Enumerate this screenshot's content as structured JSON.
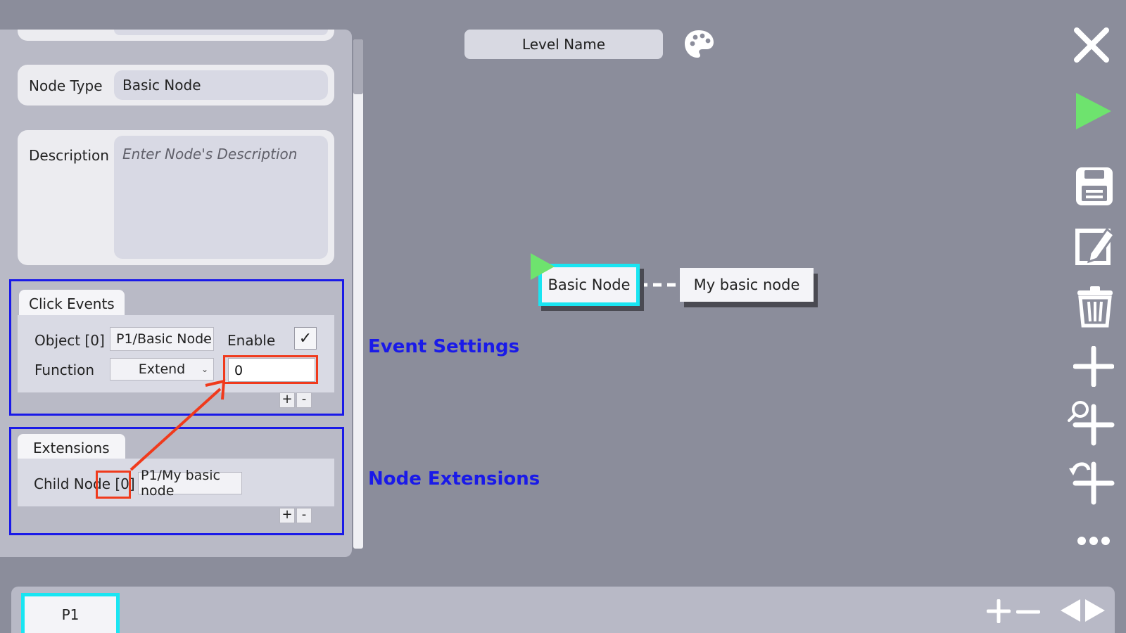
{
  "header": {
    "level_name": "Level Name"
  },
  "inspector": {
    "node_type_label": "Node Type",
    "node_type_value": "Basic Node",
    "description_label": "Description",
    "description_placeholder": "Enter Node's Description",
    "click_events": {
      "tab_label": "Click Events",
      "object_label": "Object [0]",
      "object_value": "P1/Basic Node",
      "enable_label": "Enable",
      "enable_checked": true,
      "function_label": "Function",
      "function_value": "Extend",
      "argument_value": "0",
      "add_label": "+",
      "remove_label": "-"
    },
    "extensions": {
      "tab_label": "Extensions",
      "child_node_label": "Child Node [0]",
      "child_node_value": "P1/My basic node",
      "add_label": "+",
      "remove_label": "-"
    }
  },
  "annotations": {
    "event_settings": "Event Settings",
    "node_extensions": "Node Extensions",
    "highlight_color": "#f03a1c",
    "section_color": "#1a1ae8"
  },
  "graph": {
    "nodes": [
      {
        "label": "Basic Node",
        "selected": true,
        "start": true
      },
      {
        "label": "My basic node",
        "selected": false,
        "start": false
      }
    ],
    "selection_color": "#19e5f2",
    "start_color": "#6ee36e"
  },
  "toolbar": {
    "icons": [
      "close-icon",
      "play-icon",
      "save-icon",
      "edit-icon",
      "trash-icon",
      "add-icon",
      "zoom-add-icon",
      "undo-add-icon",
      "more-icon"
    ],
    "play_color": "#6ee36e"
  },
  "pages": {
    "tabs": [
      "P1"
    ],
    "active": "P1",
    "controls": [
      "add-page-icon",
      "remove-page-icon",
      "prev-page-icon",
      "next-page-icon"
    ]
  }
}
